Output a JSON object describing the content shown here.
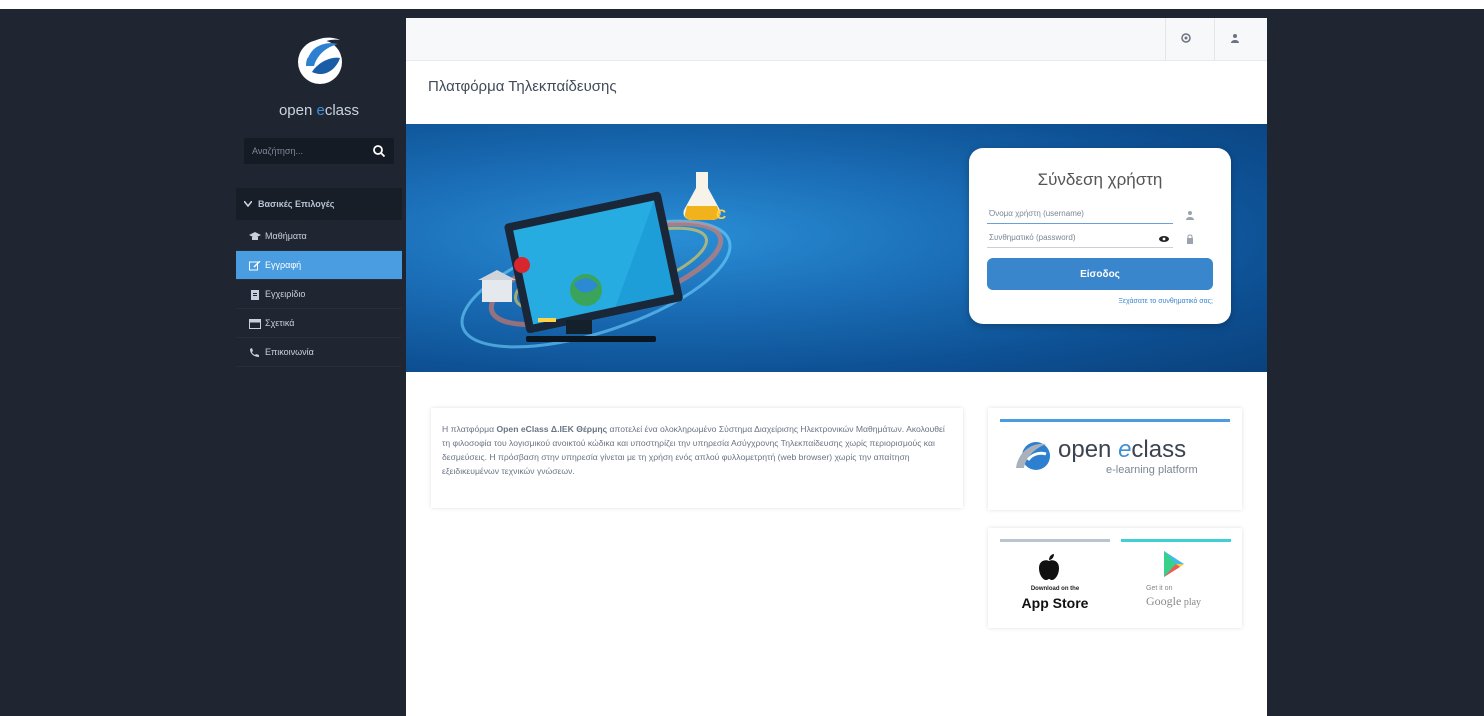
{
  "sidebar": {
    "logo_text_prefix": "open ",
    "logo_text_accent": "e",
    "logo_text_suffix": "class",
    "search_placeholder": "Αναζήτηση...",
    "section_title": "Βασικές Επιλογές",
    "items": [
      {
        "label": "Μαθήματα",
        "icon": "courses-icon",
        "active": false
      },
      {
        "label": "Εγγραφή",
        "icon": "edit-icon",
        "active": true
      },
      {
        "label": "Εγχειρίδιο",
        "icon": "manual-icon",
        "active": false
      },
      {
        "label": "Σχετικά",
        "icon": "about-icon",
        "active": false
      },
      {
        "label": "Επικοινωνία",
        "icon": "phone-icon",
        "active": false
      }
    ]
  },
  "header": {
    "page_title": "Πλατφόρμα Τηλεκπαίδευσης"
  },
  "login": {
    "title": "Σύνδεση χρήστη",
    "username_placeholder": "Όνομα χρήστη (username)",
    "password_placeholder": "Συνθηματικό (password)",
    "submit_label": "Είσοδος",
    "forgot_link": "Ξεχάσατε το συνθηματικό σας;"
  },
  "info": {
    "text_before": "Η πλατφόρμα ",
    "text_bold": "Open eClass Δ.ΙΕΚ Θέρμης",
    "text_after": " αποτελεί ένα ολοκληρωμένο Σύστημα Διαχείρισης Ηλεκτρονικών Μαθημάτων. Ακολουθεί τη φιλοσοφία του λογισμικού ανοικτού κώδικα και υποστηρίζει την υπηρεσία Ασύγχρονης Τηλεκπαίδευσης χωρίς περιορισμούς και δεσμεύσεις. Η πρόσβαση στην υπηρεσία γίνεται με τη χρήση ενός απλού φυλλομετρητή (web browser) χωρίς την απαίτηση εξειδικευμένων τεχνικών γνώσεων."
  },
  "brand": {
    "name_prefix": "open ",
    "name_accent": "e",
    "name_suffix": "class",
    "tagline": "e-learning platform"
  },
  "stores": {
    "apple_small": "Download on the",
    "apple_big": "App Store",
    "google_small": "Get it on",
    "google_big": "Google",
    "google_play": " play"
  },
  "colors": {
    "sidebar_bg": "#1f2632",
    "accent": "#4a9de0",
    "banner": "#1b6fb8",
    "login_button": "#3a86cc"
  }
}
